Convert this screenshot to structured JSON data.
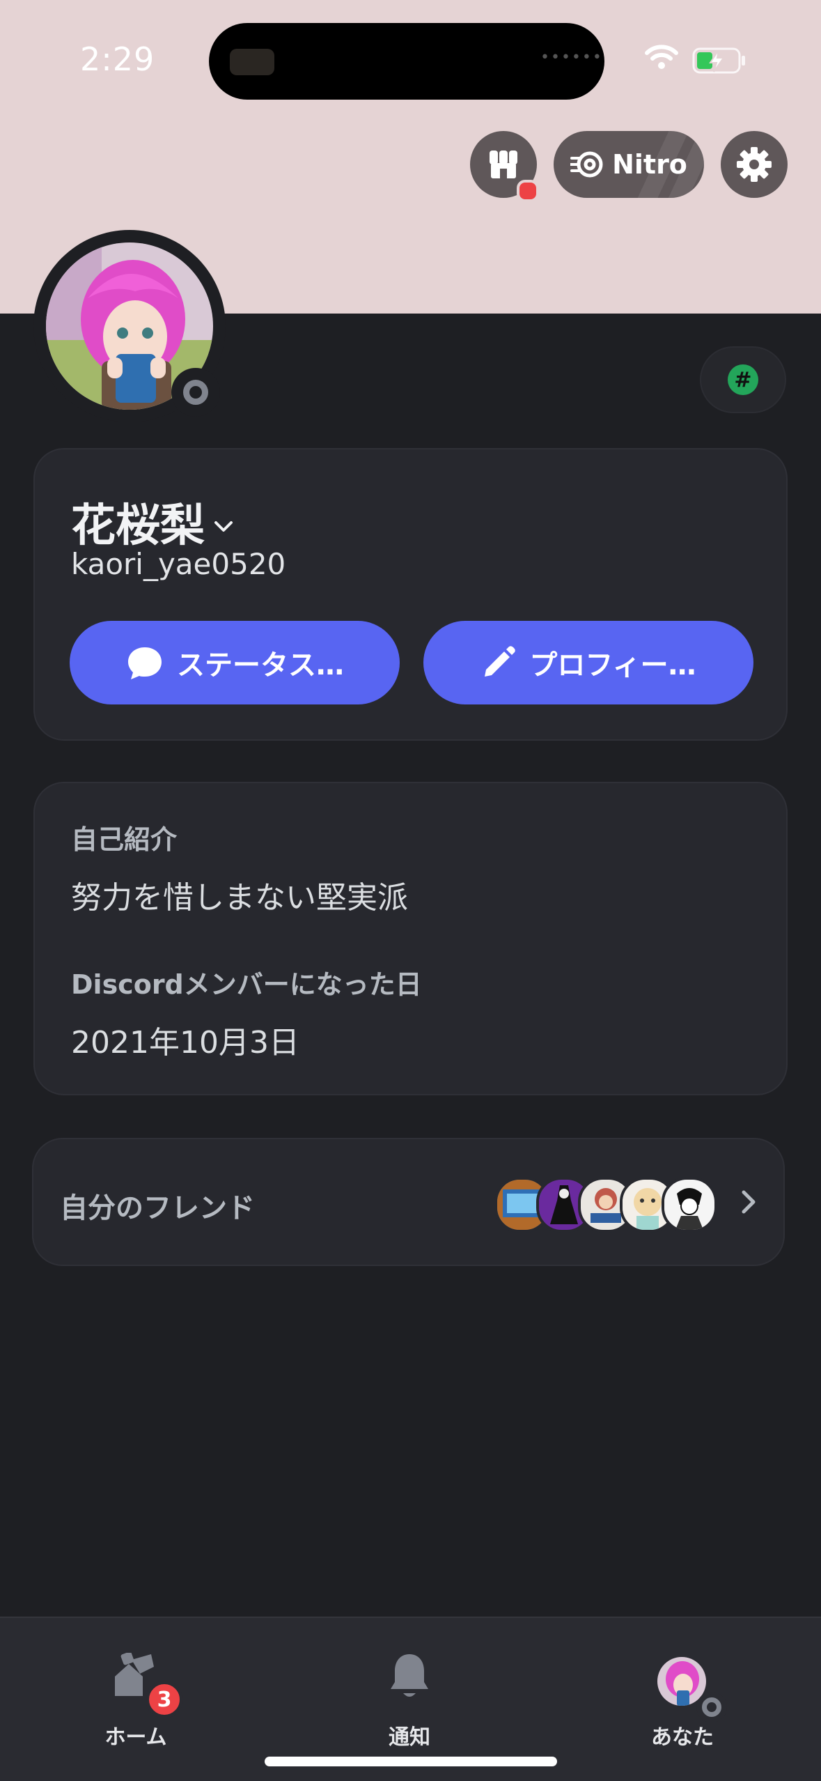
{
  "status_bar": {
    "time": "2:29"
  },
  "header": {
    "nitro_label": "Nitro"
  },
  "profile": {
    "display_name": "花桜梨",
    "username": "kaori_yae0520",
    "status_button_label": "ステータス…",
    "edit_profile_button_label": "プロフィー…"
  },
  "about": {
    "bio_label": "自己紹介",
    "bio_text": "努力を惜しまない堅実派",
    "member_since_label": "Discordメンバーになった日",
    "member_since_value": "2021年10月3日"
  },
  "friends": {
    "label": "自分のフレンド"
  },
  "tabbar": {
    "home_label": "ホーム",
    "home_badge": "3",
    "notifications_label": "通知",
    "you_label": "あなた"
  },
  "colors": {
    "banner": "#e5d3d4",
    "background": "#1e1f23",
    "card": "#27282e",
    "blurple": "#5865f2",
    "badge_red": "#ed4245",
    "status_gray": "#80848e",
    "hash_green": "#23a55a"
  },
  "icons": [
    "wifi-icon",
    "battery-charging-icon",
    "shop-icon",
    "nitro-icon",
    "gear-icon",
    "chevron-down-icon",
    "chat-bubble-icon",
    "pencil-icon",
    "chevron-right-icon",
    "home-icon",
    "bell-icon"
  ]
}
